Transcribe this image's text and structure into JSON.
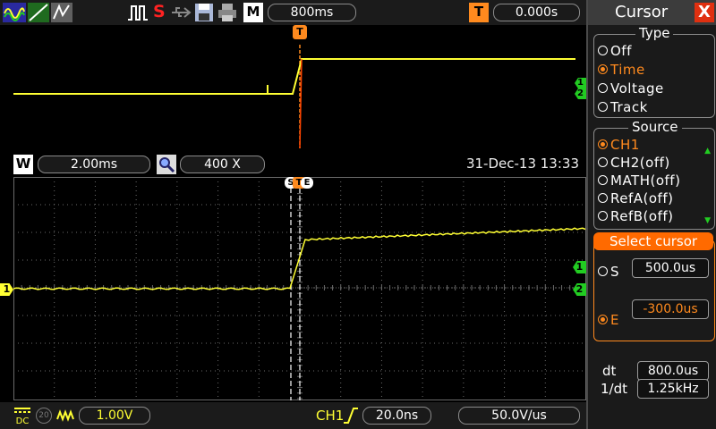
{
  "toolbar": {
    "mode_badge": "M",
    "timebase": "800ms",
    "trigger_badge": "T",
    "trigger_delay": "0.000s",
    "stop_glyph": "S"
  },
  "status": {
    "window_badge": "W",
    "window_scale": "2.00ms",
    "zoom_value": "400 X",
    "datetime": "31-Dec-13 13:33"
  },
  "channel_markers": {
    "ch1": "1",
    "ch2": "2",
    "trigger": "T",
    "cursor_s": "S",
    "cursor_e": "E"
  },
  "bottom": {
    "ch1_scale": "1.00V",
    "ch_number": "20",
    "trigger_source": "CH1",
    "trigger_time": "20.0ns",
    "trigger_slew": "50.0V/us"
  },
  "panel": {
    "title": "Cursor",
    "close": "X",
    "type_label": "Type",
    "type_options": [
      "Off",
      "Time",
      "Voltage",
      "Track"
    ],
    "type_selected": 1,
    "source_label": "Source",
    "source_options": [
      "CH1",
      "CH2(off)",
      "MATH(off)",
      "RefA(off)",
      "RefB(off)"
    ],
    "source_selected": 0,
    "select_cursor_label": "Select cursor",
    "s_label": "S",
    "s_value": "500.0us",
    "e_label": "E",
    "e_value": "-300.0us",
    "dt_label": "dt",
    "dt_value": "800.0us",
    "inv_dt_label": "1/dt",
    "inv_dt_value": "1.25kHz"
  },
  "colors": {
    "trace": "#ffff33",
    "accent": "#ff8a1e",
    "marker": "#22cc22",
    "grid": "#6a6a6a"
  }
}
